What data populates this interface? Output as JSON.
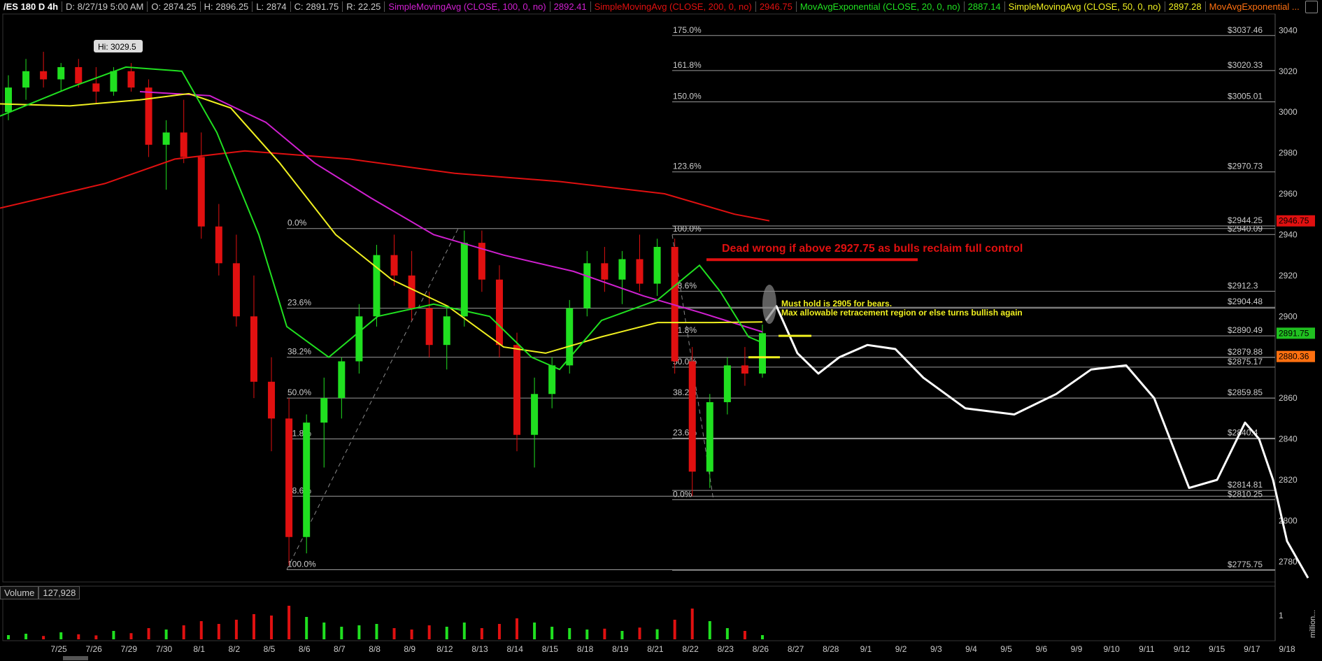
{
  "header": {
    "symbol": "/ES 180 D 4h",
    "date": "D: 8/27/19 5:00 AM",
    "open": "O: 2874.25",
    "high": "H: 2896.25",
    "low": "L: 2874",
    "close": "C: 2891.75",
    "range": "R: 22.25",
    "studies": [
      {
        "label": "SimpleMovingAvg (CLOSE, 100, 0, no)",
        "value": "2892.41",
        "color": "#d020d0"
      },
      {
        "label": "SimpleMovingAvg (CLOSE, 200, 0, no)",
        "value": "2946.75",
        "color": "#e01010"
      },
      {
        "label": "MovAvgExponential (CLOSE, 20, 0, no)",
        "value": "2887.14",
        "color": "#20e020"
      },
      {
        "label": "SimpleMovingAvg (CLOSE, 50, 0, no)",
        "value": "2897.28",
        "color": "#f0f020"
      },
      {
        "label": "MovAvgExponential ...",
        "value": "",
        "color": "#ff7010"
      }
    ]
  },
  "volume_panel": {
    "label": "Volume",
    "value": "127,928",
    "axis_ticks": [
      "1"
    ],
    "unit_label": "million..."
  },
  "annotations": {
    "high_label": "Hi: 3029.5",
    "red_note": "Dead wrong if above 2927.75 as bulls reclaim  full control",
    "yellow_note_1": "Must hold is 2905 for bears.",
    "yellow_note_2": "Max allowable retracement region or else turns bullish again"
  },
  "colors": {
    "up": "#20e020",
    "down": "#e01010",
    "grid": "#9a9a9a",
    "text": "#cccccc",
    "projection": "#ffffff"
  },
  "chart_data": {
    "type": "candlestick",
    "y_axis": {
      "range": [
        2770,
        3048
      ],
      "ticks": [
        2780,
        2800,
        2820,
        2840,
        2860,
        2880,
        2900,
        2920,
        2940,
        2960,
        2980,
        3000,
        3020,
        3040
      ]
    },
    "x_axis_labels": [
      "7/25",
      "7/26",
      "7/29",
      "7/30",
      "8/1",
      "8/2",
      "8/5",
      "8/6",
      "8/7",
      "8/8",
      "8/9",
      "8/12",
      "8/13",
      "8/14",
      "8/15",
      "8/18",
      "8/19",
      "8/21",
      "8/22",
      "8/23",
      "8/26",
      "8/27",
      "8/28",
      "9/1",
      "9/2",
      "9/3",
      "9/4",
      "9/5",
      "9/6",
      "9/9",
      "9/10",
      "9/11",
      "9/12",
      "9/15",
      "9/17",
      "9/18"
    ],
    "price_markers": [
      {
        "label": "2946.75",
        "value": 2946.75,
        "color": "#e01010"
      },
      {
        "label": "2891.75",
        "value": 2891.75,
        "color": "#20c020"
      },
      {
        "label": "2880.36",
        "value": 2880.36,
        "color": "#ff7010"
      }
    ],
    "fib_left": [
      {
        "label": "0.0%",
        "value": 2943
      },
      {
        "label": "23.6%",
        "value": 2904
      },
      {
        "label": "38.2%",
        "value": 2880
      },
      {
        "label": "50.0%",
        "value": 2860
      },
      {
        "label": "61.8%",
        "value": 2840
      },
      {
        "label": "78.6%",
        "value": 2812
      },
      {
        "label": "100.0%",
        "value": 2776
      }
    ],
    "fib_right": [
      {
        "label": "175.0%",
        "value": 3037.46,
        "price": "$3037.46"
      },
      {
        "label": "161.8%",
        "value": 3020.33,
        "price": "$3020.33"
      },
      {
        "label": "150.0%",
        "value": 3005.01,
        "price": "$3005.01"
      },
      {
        "label": "123.6%",
        "value": 2970.73,
        "price": "$2970.73"
      },
      {
        "label": "100.0%",
        "value": 2940.09,
        "price": "$2940.09"
      },
      {
        "label": "78.6%",
        "value": 2912.3,
        "price": "$2912.3"
      },
      {
        "label": "61.8%",
        "value": 2890.49,
        "price": "$2890.49"
      },
      {
        "label": "50.0%",
        "value": 2875.17,
        "price": "$2875.17"
      },
      {
        "label": "38.2%",
        "value": 2860,
        "price": "$2859.85"
      },
      {
        "label": "23.6%",
        "value": 2840.4,
        "price": "$2840.4"
      },
      {
        "label": "0.0%",
        "value": 2810.25,
        "price": "$2810.25"
      }
    ],
    "right_only_levels": [
      {
        "value": 2944.25,
        "price": "$2944.25"
      },
      {
        "value": 2904.48,
        "price": "$2904.48"
      },
      {
        "value": 2879.88,
        "price": "$2879.88"
      },
      {
        "value": 2814.81,
        "price": "$2814.81"
      },
      {
        "value": 2775.75,
        "price": "$2775.75"
      }
    ],
    "candles": [
      [
        3000,
        3018,
        2996,
        3012
      ],
      [
        3012,
        3026,
        3006,
        3020
      ],
      [
        3020,
        3029.5,
        3012,
        3016
      ],
      [
        3016,
        3024,
        3010,
        3022
      ],
      [
        3022,
        3026,
        3012,
        3014
      ],
      [
        3014,
        3022,
        3004,
        3010
      ],
      [
        3010,
        3022,
        3008,
        3020
      ],
      [
        3020,
        3024,
        3010,
        3012
      ],
      [
        3012,
        3016,
        2978,
        2984
      ],
      [
        2984,
        2996,
        2962,
        2990
      ],
      [
        2990,
        3006,
        2975,
        2978
      ],
      [
        2978,
        2990,
        2938,
        2944
      ],
      [
        2944,
        2955,
        2920,
        2926
      ],
      [
        2926,
        2940,
        2895,
        2900
      ],
      [
        2900,
        2920,
        2860,
        2868
      ],
      [
        2868,
        2880,
        2834,
        2850
      ],
      [
        2850,
        2860,
        2778,
        2792
      ],
      [
        2792,
        2852,
        2784,
        2848
      ],
      [
        2848,
        2870,
        2826,
        2860
      ],
      [
        2860,
        2880,
        2850,
        2878
      ],
      [
        2878,
        2906,
        2872,
        2900
      ],
      [
        2900,
        2935,
        2895,
        2930
      ],
      [
        2930,
        2940,
        2915,
        2920
      ],
      [
        2920,
        2932,
        2898,
        2904
      ],
      [
        2904,
        2912,
        2880,
        2886
      ],
      [
        2886,
        2905,
        2874,
        2900
      ],
      [
        2900,
        2942,
        2895,
        2936
      ],
      [
        2936,
        2942,
        2912,
        2918
      ],
      [
        2918,
        2925,
        2880,
        2886
      ],
      [
        2886,
        2892,
        2834,
        2842
      ],
      [
        2842,
        2870,
        2826,
        2862
      ],
      [
        2862,
        2880,
        2855,
        2876
      ],
      [
        2876,
        2908,
        2872,
        2904
      ],
      [
        2904,
        2932,
        2900,
        2926
      ],
      [
        2926,
        2934,
        2912,
        2918
      ],
      [
        2918,
        2932,
        2906,
        2928
      ],
      [
        2928,
        2940,
        2912,
        2916
      ],
      [
        2916,
        2938,
        2910,
        2934
      ],
      [
        2934,
        2938,
        2872,
        2878
      ],
      [
        2878,
        2885,
        2812,
        2824
      ],
      [
        2824,
        2862,
        2816,
        2858
      ],
      [
        2858,
        2880,
        2852,
        2876
      ],
      [
        2876,
        2885,
        2866,
        2872
      ],
      [
        2872,
        2896,
        2870,
        2891.75
      ]
    ],
    "volume": [
      0.15,
      0.2,
      0.12,
      0.25,
      0.18,
      0.14,
      0.3,
      0.22,
      0.4,
      0.35,
      0.5,
      0.65,
      0.55,
      0.7,
      0.9,
      0.85,
      1.2,
      0.8,
      0.6,
      0.45,
      0.5,
      0.55,
      0.4,
      0.35,
      0.5,
      0.45,
      0.6,
      0.4,
      0.55,
      0.75,
      0.6,
      0.45,
      0.4,
      0.35,
      0.38,
      0.3,
      0.42,
      0.36,
      0.7,
      1.1,
      0.65,
      0.4,
      0.3,
      0.15
    ],
    "moving_averages": [
      {
        "name": "SimpleMovingAvg (CLOSE, 200, 0, no)",
        "color": "#e01010",
        "values": [
          [
            0,
            2953
          ],
          [
            150,
            2965
          ],
          [
            250,
            2977
          ],
          [
            350,
            2981
          ],
          [
            500,
            2977
          ],
          [
            650,
            2970
          ],
          [
            800,
            2966
          ],
          [
            950,
            2960
          ],
          [
            1050,
            2950
          ],
          [
            1100,
            2946.75
          ]
        ]
      },
      {
        "name": "SimpleMovingAvg (CLOSE, 100, 0, no)",
        "color": "#d020d0",
        "values": [
          [
            200,
            3010
          ],
          [
            300,
            3008
          ],
          [
            380,
            2995
          ],
          [
            450,
            2975
          ],
          [
            530,
            2958
          ],
          [
            620,
            2940
          ],
          [
            720,
            2930
          ],
          [
            820,
            2922
          ],
          [
            920,
            2910
          ],
          [
            1000,
            2902
          ],
          [
            1090,
            2892.41
          ]
        ]
      },
      {
        "name": "SimpleMovingAvg (CLOSE, 50, 0, no)",
        "color": "#f0f020",
        "values": [
          [
            0,
            3004
          ],
          [
            100,
            3003
          ],
          [
            200,
            3006
          ],
          [
            270,
            3009
          ],
          [
            330,
            3002
          ],
          [
            400,
            2975
          ],
          [
            480,
            2940
          ],
          [
            560,
            2918
          ],
          [
            640,
            2905
          ],
          [
            720,
            2885
          ],
          [
            780,
            2882
          ],
          [
            860,
            2890
          ],
          [
            940,
            2897
          ],
          [
            1020,
            2897
          ],
          [
            1090,
            2897.28
          ]
        ]
      },
      {
        "name": "MovAvgExponential (CLOSE, 20, 0, no)",
        "color": "#20e020",
        "values": [
          [
            0,
            2998
          ],
          [
            100,
            3012
          ],
          [
            180,
            3022
          ],
          [
            260,
            3020
          ],
          [
            310,
            2990
          ],
          [
            370,
            2940
          ],
          [
            410,
            2895
          ],
          [
            470,
            2880
          ],
          [
            540,
            2900
          ],
          [
            620,
            2906
          ],
          [
            700,
            2900
          ],
          [
            760,
            2880
          ],
          [
            800,
            2874
          ],
          [
            860,
            2898
          ],
          [
            940,
            2908
          ],
          [
            1000,
            2925
          ],
          [
            1030,
            2912
          ],
          [
            1070,
            2890
          ],
          [
            1090,
            2887.14
          ]
        ]
      }
    ],
    "projection_path": [
      [
        1095,
        2898
      ],
      [
        1110,
        2905
      ],
      [
        1140,
        2882
      ],
      [
        1170,
        2872
      ],
      [
        1200,
        2880
      ],
      [
        1240,
        2886
      ],
      [
        1280,
        2884
      ],
      [
        1320,
        2870
      ],
      [
        1380,
        2855
      ],
      [
        1450,
        2852
      ],
      [
        1510,
        2862
      ],
      [
        1560,
        2874
      ],
      [
        1610,
        2876
      ],
      [
        1650,
        2860
      ],
      [
        1700,
        2816
      ],
      [
        1740,
        2820
      ],
      [
        1780,
        2848
      ],
      [
        1800,
        2840
      ],
      [
        1820,
        2820
      ],
      [
        1840,
        2790
      ],
      [
        1870,
        2772
      ]
    ]
  }
}
